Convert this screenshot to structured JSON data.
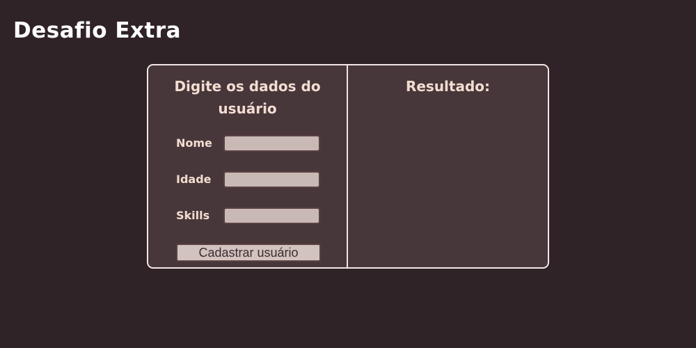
{
  "page": {
    "title": "Desafio Extra"
  },
  "form": {
    "heading": "Digite os dados do usuário",
    "fields": [
      {
        "label": "Nome",
        "value": "",
        "placeholder": ""
      },
      {
        "label": "Idade",
        "value": "",
        "placeholder": ""
      },
      {
        "label": "Skills",
        "value": "",
        "placeholder": ""
      }
    ],
    "submit_label": "Cadastrar usuário"
  },
  "result": {
    "heading": "Resultado:",
    "content": ""
  },
  "colors": {
    "background": "#2f2327",
    "card": "#48373a",
    "border": "#f2e8e6",
    "text": "#f3ddd2",
    "input": "#c9b9b4",
    "button": "#d3c3be"
  }
}
